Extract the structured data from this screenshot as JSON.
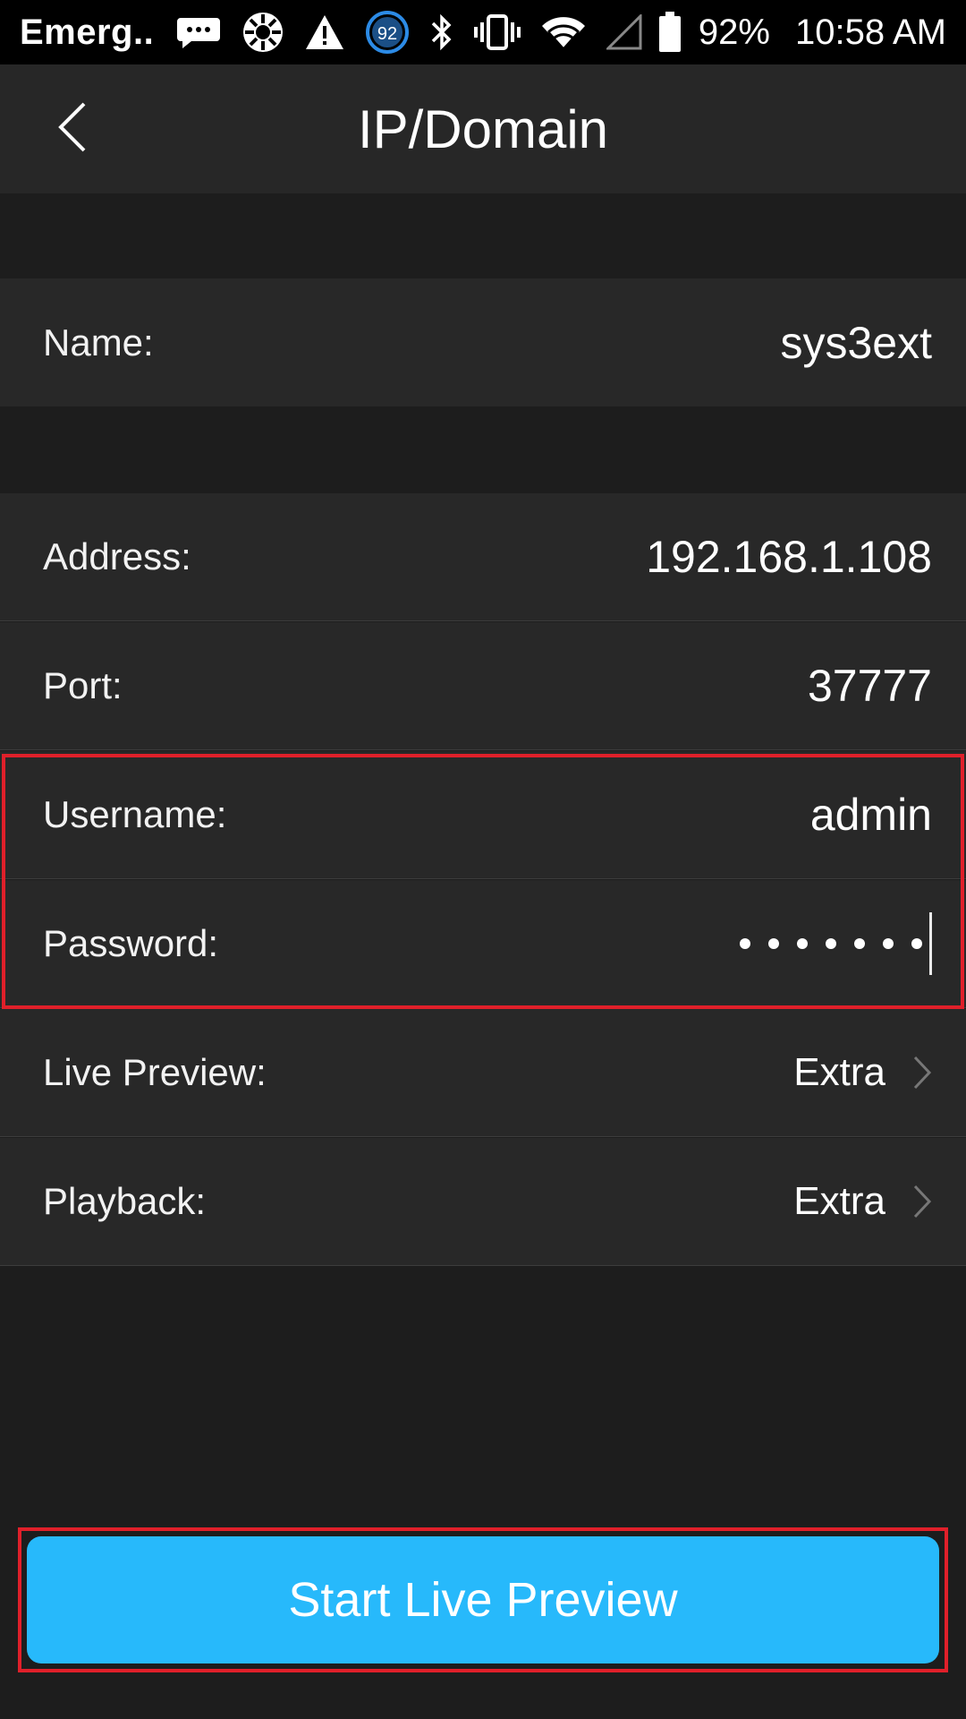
{
  "status_bar": {
    "carrier": "Emerg..",
    "badge_number": "92",
    "battery_percent": "92%",
    "time": "10:58 AM",
    "icons": [
      "message-icon",
      "settings-app-icon",
      "warning-icon",
      "badge-icon",
      "bluetooth-icon",
      "vibrate-icon",
      "wifi-icon",
      "signal-icon",
      "battery-icon"
    ]
  },
  "header": {
    "title": "IP/Domain",
    "back_icon": "chevron-left-icon"
  },
  "form": {
    "name": {
      "label": "Name:",
      "value": "sys3ext"
    },
    "address": {
      "label": "Address:",
      "value": "192.168.1.108"
    },
    "port": {
      "label": "Port:",
      "value": "37777"
    },
    "username": {
      "label": "Username:",
      "value": "admin"
    },
    "password": {
      "label": "Password:",
      "masked_length": 7
    },
    "live_preview": {
      "label": "Live Preview:",
      "value": "Extra"
    },
    "playback": {
      "label": "Playback:",
      "value": "Extra"
    }
  },
  "actions": {
    "start_label": "Start Live Preview"
  },
  "colors": {
    "accent": "#27b9fb",
    "highlight": "#e0202a",
    "row_bg": "#282828",
    "page_bg": "#1d1d1d"
  }
}
